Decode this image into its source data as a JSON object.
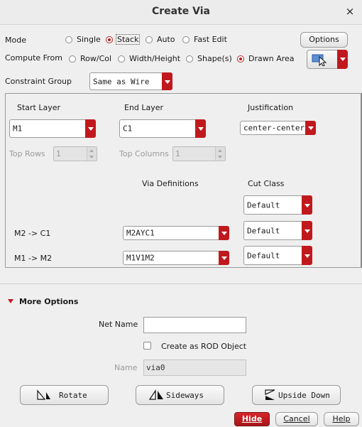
{
  "window": {
    "title": "Create Via",
    "close_label": "×"
  },
  "mode": {
    "label": "Mode",
    "options": [
      "Single",
      "Stack",
      "Auto",
      "Fast Edit"
    ],
    "selected": "Stack"
  },
  "compute_from": {
    "label": "Compute From",
    "options": [
      "Row/Col",
      "Width/Height",
      "Shape(s)",
      "Drawn Area"
    ],
    "selected": "Drawn Area"
  },
  "options_button": "Options",
  "constraint_group": {
    "label": "Constraint Group",
    "value": "Same as Wire"
  },
  "layers": {
    "start_label": "Start Layer",
    "start_value": "M1",
    "end_label": "End Layer",
    "end_value": "C1",
    "justification_label": "Justification",
    "justification_value": "center-center"
  },
  "rows_cols": {
    "top_rows_label": "Top Rows",
    "top_rows_value": "1",
    "top_columns_label": "Top Columns",
    "top_columns_value": "1"
  },
  "via_table": {
    "via_definitions_header": "Via Definitions",
    "cut_class_header": "Cut Class",
    "top_cut_class": "Default",
    "rows": [
      {
        "layers": "M2 -> C1",
        "via_definition": "M2AYC1",
        "cut_class": "Default"
      },
      {
        "layers": "M1 -> M2",
        "via_definition": "M1V1M2",
        "cut_class": "Default"
      }
    ]
  },
  "more_options": {
    "label": "More Options",
    "net_name_label": "Net Name",
    "net_name_value": "",
    "rod_label": "Create as ROD Object",
    "name_label": "Name",
    "name_value": "via0"
  },
  "actions": {
    "rotate": "Rotate",
    "sideways": "Sideways",
    "upside_down": "Upside Down"
  },
  "footer": {
    "hide": "Hide",
    "cancel": "Cancel",
    "help": "Help"
  },
  "colors": {
    "accent": "#c0191d",
    "background": "#efefef"
  }
}
